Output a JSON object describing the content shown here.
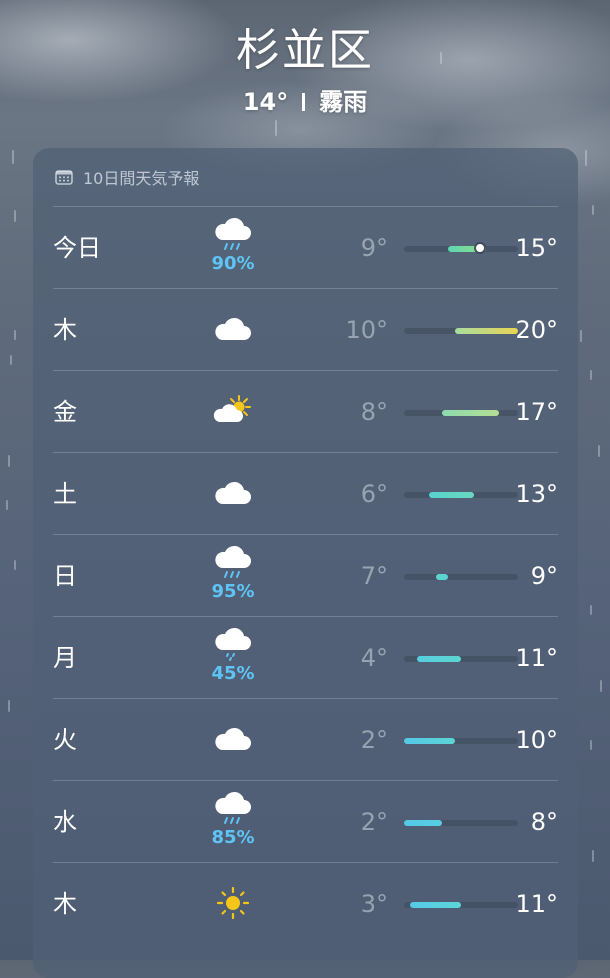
{
  "location": {
    "name": "杉並区"
  },
  "current": {
    "temp": "14°",
    "condition": "霧雨"
  },
  "forecast": {
    "title": "10日間天気予報",
    "range_min": 2,
    "range_max": 20,
    "days": [
      {
        "day": "今日",
        "icon": "rain-cloud-icon",
        "precip": "90%",
        "low": "9°",
        "high": "15°",
        "low_val": 9,
        "high_val": 15,
        "current_val": 14,
        "colors": [
          "#5ed6b0",
          "#8fdc8a"
        ]
      },
      {
        "day": "木",
        "icon": "cloud-icon",
        "precip": "",
        "low": "10°",
        "high": "20°",
        "low_val": 10,
        "high_val": 20,
        "colors": [
          "#a8dca0",
          "#e8d552"
        ]
      },
      {
        "day": "金",
        "icon": "partly-sunny-icon",
        "precip": "",
        "low": "8°",
        "high": "17°",
        "low_val": 8,
        "high_val": 17,
        "colors": [
          "#8cdcb0",
          "#b6dc92"
        ]
      },
      {
        "day": "土",
        "icon": "cloud-icon",
        "precip": "",
        "low": "6°",
        "high": "13°",
        "low_val": 6,
        "high_val": 13,
        "colors": [
          "#57d2d0",
          "#6ad8c0"
        ]
      },
      {
        "day": "日",
        "icon": "rain-cloud-icon",
        "precip": "95%",
        "low": "7°",
        "high": "9°",
        "low_val": 7,
        "high_val": 9,
        "colors": [
          "#5ed4d2",
          "#5ed4d2"
        ]
      },
      {
        "day": "月",
        "icon": "drizzle-cloud-icon",
        "precip": "45%",
        "low": "4°",
        "high": "11°",
        "low_val": 4,
        "high_val": 11,
        "colors": [
          "#58cde0",
          "#5cd6d0"
        ]
      },
      {
        "day": "火",
        "icon": "cloud-icon",
        "precip": "",
        "low": "2°",
        "high": "10°",
        "low_val": 2,
        "high_val": 10,
        "colors": [
          "#55c8e8",
          "#5cd4d4"
        ]
      },
      {
        "day": "水",
        "icon": "rain-cloud-icon",
        "precip": "85%",
        "low": "2°",
        "high": "8°",
        "low_val": 2,
        "high_val": 8,
        "colors": [
          "#55c8e8",
          "#58cfe0"
        ]
      },
      {
        "day": "木",
        "icon": "sun-icon",
        "precip": "",
        "low": "3°",
        "high": "11°",
        "low_val": 3,
        "high_val": 11,
        "colors": [
          "#56cae6",
          "#5cd6d6"
        ]
      }
    ]
  }
}
